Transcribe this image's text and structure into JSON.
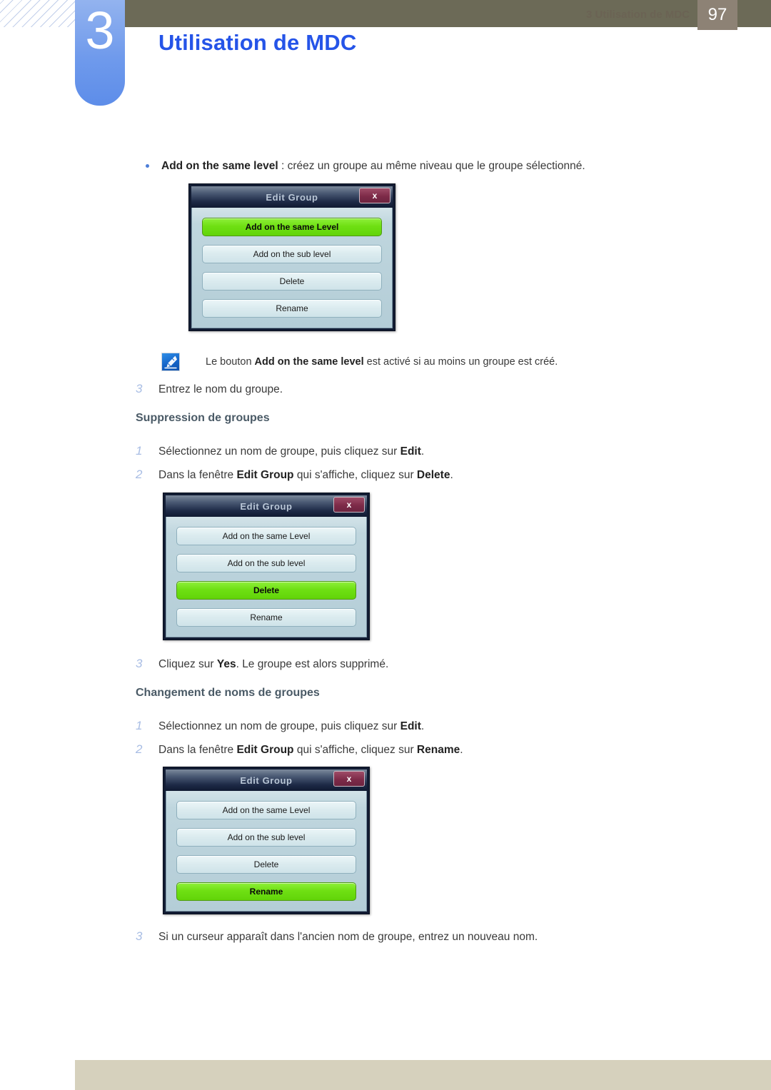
{
  "header": {
    "chapter_number": "3",
    "chapter_title": "Utilisation de MDC"
  },
  "content": {
    "bullet": {
      "term": "Add on the same level",
      "rest": " : créez un groupe au même niveau que le groupe sélectionné."
    },
    "note": {
      "icon": "note-pen-icon",
      "pre": "Le bouton ",
      "bold": "Add on the same level",
      "post": " est activé si au moins un groupe est créé."
    },
    "step_after_first_dialog": {
      "num": "3",
      "text": "Entrez le nom du groupe."
    },
    "sections": [
      {
        "heading": "Suppression de groupes",
        "steps": [
          {
            "num": "1",
            "pre": "Sélectionnez un nom de groupe, puis cliquez sur ",
            "bold": "Edit",
            "post": "."
          },
          {
            "num": "2",
            "pre": "Dans la fenêtre ",
            "bold": "Edit Group",
            "post": " qui s'affiche, cliquez sur ",
            "bold2": "Delete",
            "post2": "."
          }
        ],
        "closing_step": {
          "num": "3",
          "pre": "Cliquez sur ",
          "bold": "Yes",
          "post": ". Le groupe est alors supprimé."
        }
      },
      {
        "heading": "Changement de noms de groupes",
        "steps": [
          {
            "num": "1",
            "pre": "Sélectionnez un nom de groupe, puis cliquez sur ",
            "bold": "Edit",
            "post": "."
          },
          {
            "num": "2",
            "pre": "Dans la fenêtre ",
            "bold": "Edit Group",
            "post": " qui s'affiche, cliquez sur ",
            "bold2": "Rename",
            "post2": "."
          }
        ],
        "closing_step": {
          "num": "3",
          "pre": "Si un curseur apparaît dans l'ancien nom de groupe, entrez un nouveau nom.",
          "bold": "",
          "post": ""
        }
      }
    ]
  },
  "dialogs": [
    {
      "title": "Edit Group",
      "close_label": "x",
      "buttons": [
        {
          "label": "Add on the same Level",
          "active": true
        },
        {
          "label": "Add on the sub level",
          "active": false
        },
        {
          "label": "Delete",
          "active": false
        },
        {
          "label": "Rename",
          "active": false
        }
      ]
    },
    {
      "title": "Edit Group",
      "close_label": "x",
      "buttons": [
        {
          "label": "Add on the same Level",
          "active": false
        },
        {
          "label": "Add on the sub level",
          "active": false
        },
        {
          "label": "Delete",
          "active": true
        },
        {
          "label": "Rename",
          "active": false
        }
      ]
    },
    {
      "title": "Edit Group",
      "close_label": "x",
      "buttons": [
        {
          "label": "Add on the same Level",
          "active": false
        },
        {
          "label": "Add on the sub level",
          "active": false
        },
        {
          "label": "Delete",
          "active": false
        },
        {
          "label": "Rename",
          "active": true
        }
      ]
    }
  ],
  "footer": {
    "text": "3 Utilisation de MDC",
    "page": "97"
  },
  "colors": {
    "header_band": "#6c6a57",
    "chapter_tab": "#6f9aec",
    "chapter_title": "#2554e8",
    "step_number": "#a8bde4",
    "section_heading": "#4a5a66",
    "dialog_active_button": "#6fe013",
    "footer_bar": "#d6d1bd",
    "footer_page_box": "#8d8275"
  }
}
